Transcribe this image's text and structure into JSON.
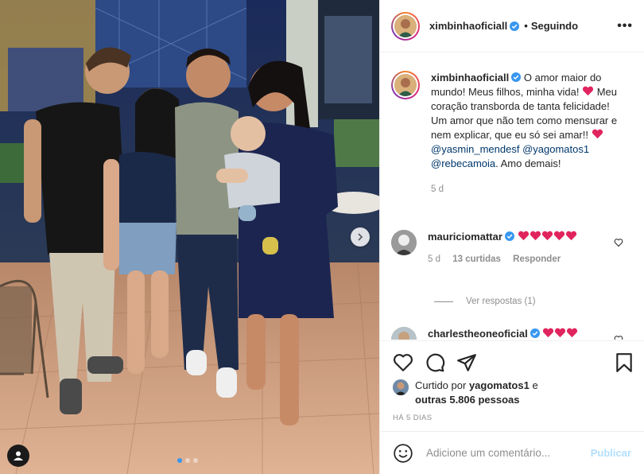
{
  "post": {
    "author": "ximbinhaoficiall",
    "follow_sep": "•",
    "follow_label": "Seguindo",
    "more_label": "•••"
  },
  "caption": {
    "author": "ximbinhaoficiall",
    "text_1": "O amor maior do mundo! Meus filhos, minha vida!",
    "text_2": "Meu coração transborda de tanta felicidade! Um amor que não tem como mensurar e nem explicar, que eu só sei amar!!",
    "mention_1": "@yasmin_mendesf",
    "mention_2": "@yagomatos1",
    "mention_3": "@rebecamoia",
    "text_3": ". Amo demais!",
    "time": "5 d"
  },
  "comments": [
    {
      "user": "mauriciomattar",
      "time": "5 d",
      "likes": "13 curtidas",
      "reply": "Responder"
    },
    {
      "user": "charlestheoneoficial"
    }
  ],
  "view_replies": "Ver respostas (1)",
  "likes": {
    "prefix": "Curtido por",
    "user": "yagomatos1",
    "conj": "e",
    "others": "outras 5.806 pessoas"
  },
  "timestamp": "HÁ 5 DIAS",
  "add_comment": {
    "placeholder": "Adicione um comentário...",
    "publish": "Publicar"
  },
  "colors": {
    "heart": "#ed4956",
    "verified": "#3897f0",
    "link": "#00376b",
    "publish": "#b2dffc"
  },
  "icons": [
    "heart-icon",
    "comment-icon",
    "share-icon",
    "bookmark-icon",
    "emoji-icon",
    "verified-icon",
    "chevron-right-icon",
    "user-tag-icon"
  ],
  "carousel": {
    "slides": 3,
    "active": 1
  }
}
